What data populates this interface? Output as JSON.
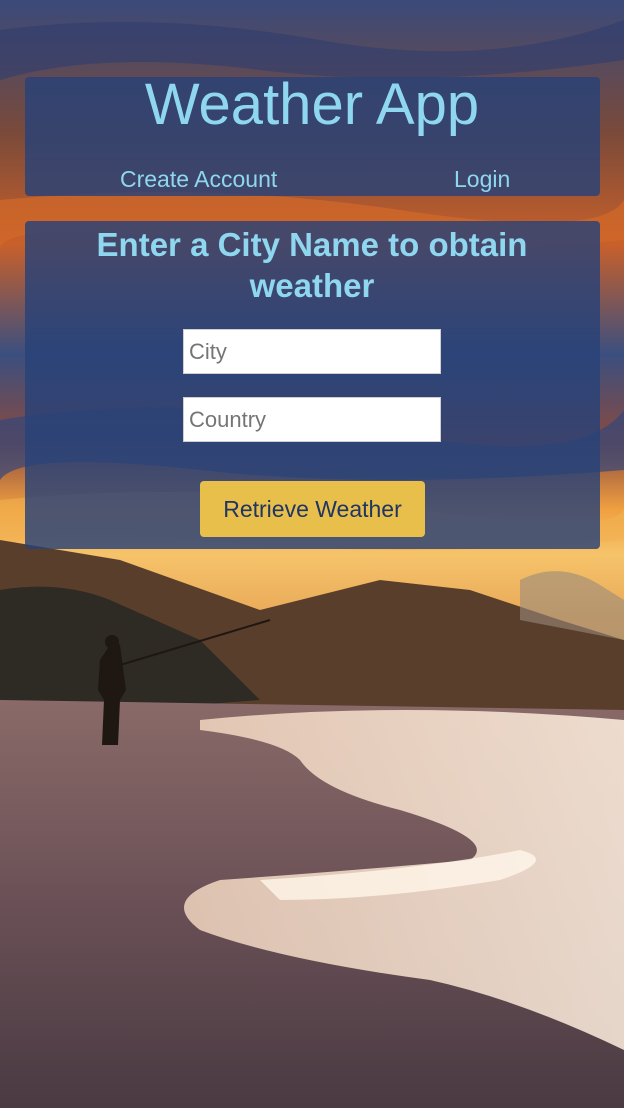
{
  "header": {
    "title": "Weather App",
    "nav": {
      "create_account": "Create Account",
      "login": "Login"
    }
  },
  "form": {
    "heading": "Enter a City Name to obtain weather",
    "city": {
      "placeholder": "City",
      "value": ""
    },
    "country": {
      "placeholder": "Country",
      "value": ""
    },
    "submit_label": "Retrieve Weather"
  },
  "colors": {
    "title_text": "#8fd7ef",
    "panel": "#284278",
    "button": "#e9bf4c",
    "button_text": "#1f3564"
  }
}
